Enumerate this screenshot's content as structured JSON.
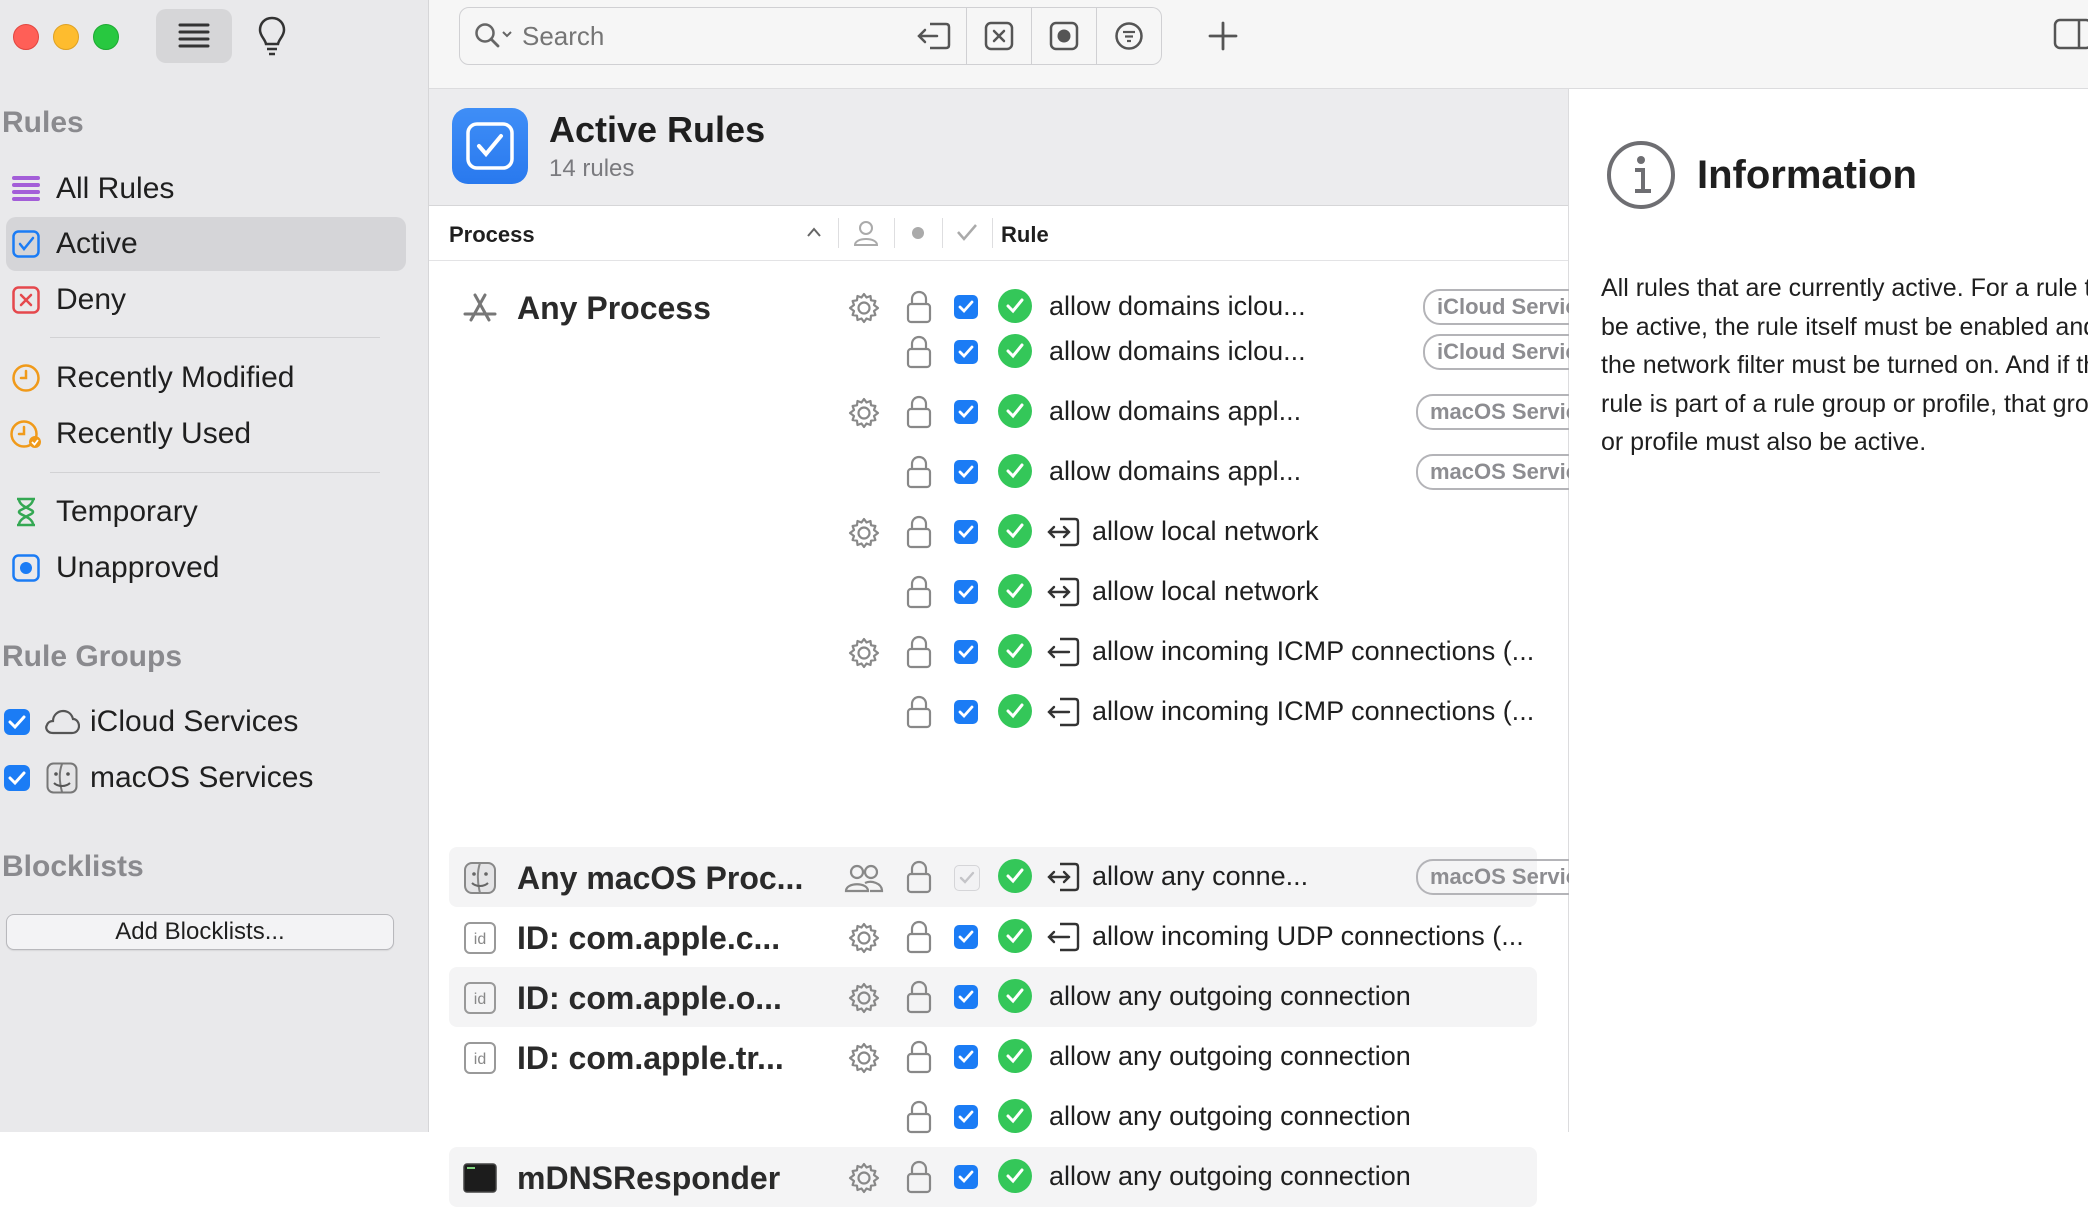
{
  "sidebar": {
    "rules_header": "Rules",
    "items": [
      {
        "label": "All Rules",
        "icon": "list-icon"
      },
      {
        "label": "Active",
        "icon": "checkbox-icon"
      },
      {
        "label": "Deny",
        "icon": "x-box-icon"
      },
      {
        "label": "Recently Modified",
        "icon": "clock-icon"
      },
      {
        "label": "Recently Used",
        "icon": "clock-check-icon"
      },
      {
        "label": "Temporary",
        "icon": "hourglass-icon"
      },
      {
        "label": "Unapproved",
        "icon": "dot-box-icon"
      }
    ],
    "groups_header": "Rule Groups",
    "groups": [
      {
        "label": "iCloud Services",
        "icon": "cloud-icon"
      },
      {
        "label": "macOS Services",
        "icon": "finder-icon"
      }
    ],
    "blocklists_header": "Blocklists",
    "add_blocklists": "Add Blocklists..."
  },
  "toolbar": {
    "search_placeholder": "Search"
  },
  "header": {
    "title": "Active Rules",
    "subtitle": "14 rules"
  },
  "columns": {
    "process": "Process",
    "rule": "Rule"
  },
  "rows": [
    {
      "process": "Any Process",
      "rule": "allow domains iclou...",
      "badge": "iCloud Services"
    },
    {
      "process": "",
      "rule": "allow domains iclou...",
      "badge": "iCloud Services"
    },
    {
      "process": "",
      "rule": "allow domains appl...",
      "badge": "macOS Services"
    },
    {
      "process": "",
      "rule": "allow domains appl...",
      "badge": "macOS Services"
    },
    {
      "process": "",
      "rule": "allow local network",
      "badge": ""
    },
    {
      "process": "",
      "rule": "allow local network",
      "badge": ""
    },
    {
      "process": "",
      "rule": "allow incoming ICMP connections (...",
      "badge": ""
    },
    {
      "process": "",
      "rule": "allow incoming ICMP connections (...",
      "badge": ""
    },
    {
      "process": "Any macOS Proc...",
      "rule": "allow any conne...",
      "badge": "macOS Services"
    },
    {
      "process": "ID: com.apple.c...",
      "rule": "allow incoming UDP connections (...",
      "badge": ""
    },
    {
      "process": "ID: com.apple.o...",
      "rule": "allow any outgoing connection",
      "badge": ""
    },
    {
      "process": "ID: com.apple.tr...",
      "rule": "allow any outgoing connection",
      "badge": ""
    },
    {
      "process": "",
      "rule": "allow any outgoing connection",
      "badge": ""
    },
    {
      "process": "mDNSResponder",
      "rule": "allow any outgoing connection",
      "badge": ""
    }
  ],
  "info": {
    "title": "Information",
    "text": "All rules that are currently active. For a rule to be active, the rule itself must be enabled and the network filter must be turned on. And if the rule is part of a rule group or profile, that group or profile must also be active."
  },
  "colors": {
    "accent": "#1b7cf5",
    "ok_green": "#34c759",
    "sidebar_bg": "#e9e9eb"
  }
}
